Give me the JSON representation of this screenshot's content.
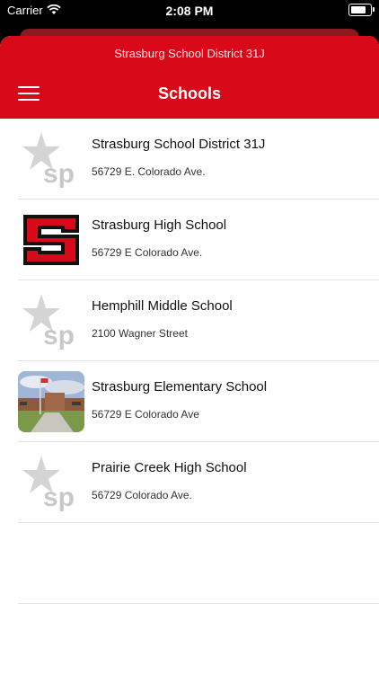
{
  "status_bar": {
    "carrier": "Carrier",
    "time": "2:08 PM"
  },
  "header": {
    "subtitle": "Strasburg School District 31J",
    "title": "Schools",
    "background_color": "#d80a1a"
  },
  "schools": [
    {
      "name": "Strasburg School District 31J",
      "address": "56729 E. Colorado Ave.",
      "logo": "sp-placeholder-icon"
    },
    {
      "name": "Strasburg High School",
      "address": "56729 E Colorado Ave.",
      "logo": "s-logo-icon"
    },
    {
      "name": "Hemphill Middle School",
      "address": "2100 Wagner Street",
      "logo": "sp-placeholder-icon"
    },
    {
      "name": "Strasburg Elementary School",
      "address": "56729 E Colorado Ave",
      "logo": "school-building-photo"
    },
    {
      "name": "Prairie Creek High School",
      "address": "56729 Colorado Ave.",
      "logo": "sp-placeholder-icon"
    }
  ]
}
